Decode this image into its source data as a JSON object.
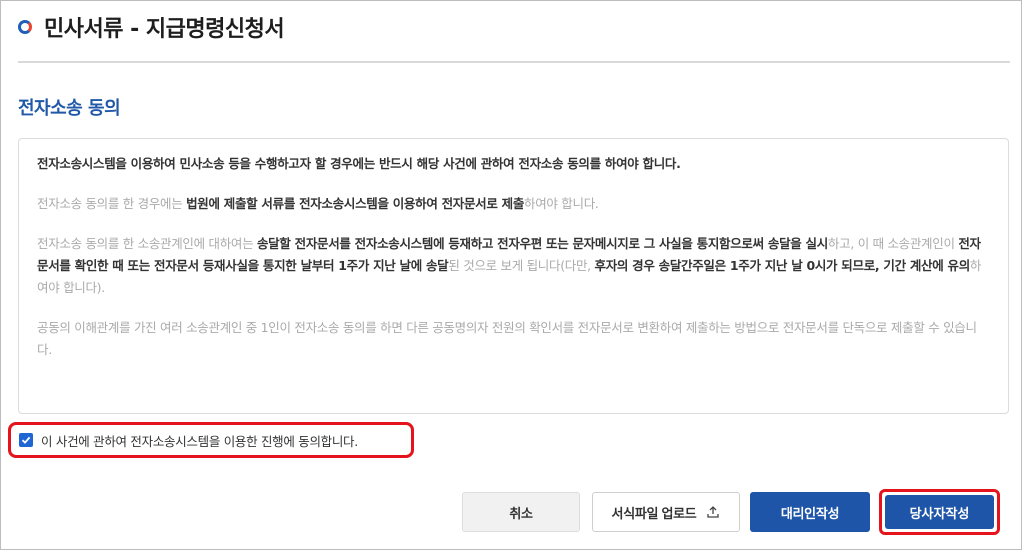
{
  "header": {
    "title": "민사서류 - 지급명령신청서",
    "logo_icon": "court-logo-icon"
  },
  "section": {
    "title": "전자소송 동의"
  },
  "notice": {
    "p1": "전자소송시스템을 이용하여 민사소송 등을 수행하고자 할 경우에는 반드시 해당 사건에 관하여 전자소송 동의를 하여야 합니다.",
    "p2": [
      {
        "t": "전자소송 동의를 한 경우에는 ",
        "b": false
      },
      {
        "t": "법원에 제출할 서류를 전자소송시스템을 이용하여 전자문서로 제출",
        "b": true
      },
      {
        "t": "하여야 합니다.",
        "b": false
      }
    ],
    "p3": [
      {
        "t": "전자소송 동의를 한 소송관계인에 대하여는 ",
        "b": false
      },
      {
        "t": "송달할 전자문서를 전자소송시스템에 등재하고 전자우편 또는 문자메시지로 그 사실을 통지함으로써 송달을 실시",
        "b": true
      },
      {
        "t": "하고, 이 때 소송관계인이 ",
        "b": false
      },
      {
        "t": "전자문서를 확인한 때 또는 전자문서 등재사실을 통지한 날부터 1주가 지난 날에 송달",
        "b": true
      },
      {
        "t": "된 것으로 보게 됩니다(다만, ",
        "b": false
      },
      {
        "t": "후자의 경우 송달간주일은 1주가 지난 날 0시가 되므로, 기간 계산에 유의",
        "b": true
      },
      {
        "t": "하여야 합니다).",
        "b": false
      }
    ],
    "p4": "공동의 이해관계를 가진 여러 소송관계인 중 1인이 전자소송 동의를 하면 다른 공동명의자 전원의 확인서를 전자문서로 변환하여 제출하는 방법으로 전자문서를 단독으로 제출할 수 있습니다."
  },
  "agreement": {
    "label": "이 사건에 관하여 전자소송시스템을 이용한 진행에 동의합니다.",
    "checked": true
  },
  "buttons": {
    "cancel": "취소",
    "upload": "서식파일 업로드",
    "upload_icon": "upload-icon",
    "agent": "대리인작성",
    "party": "당사자작성"
  },
  "colors": {
    "accent": "#1e55a8",
    "highlight": "#e5141c",
    "checkbox": "#1f66d4"
  }
}
